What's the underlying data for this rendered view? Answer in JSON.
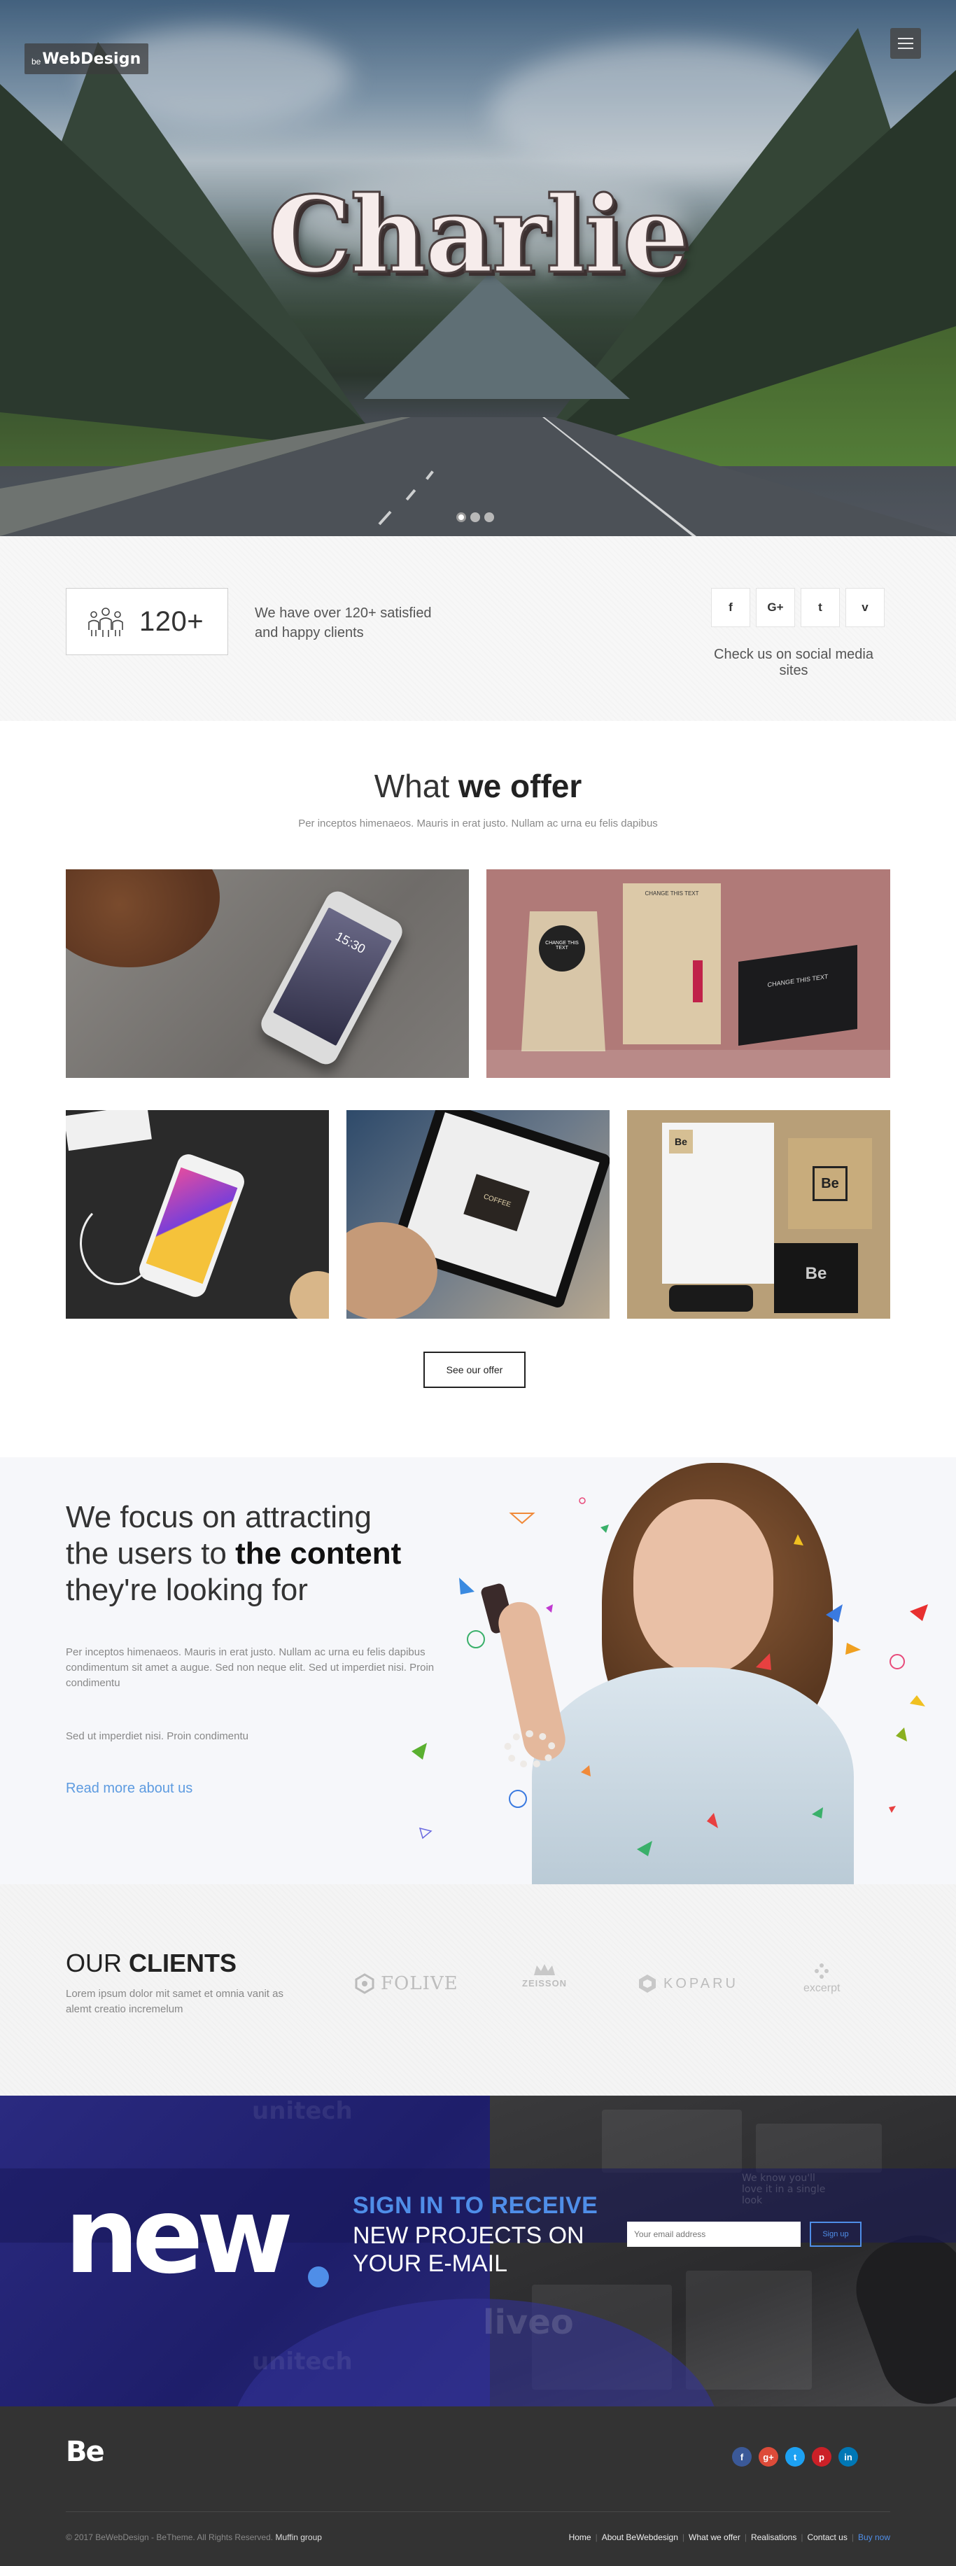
{
  "header": {
    "logo_prefix": "be",
    "logo_name": "WebDesign",
    "menu_icon": "hamburger-icon"
  },
  "hero": {
    "title": "Charlie",
    "slides": 3,
    "active_slide": 1
  },
  "stats": {
    "counter_value": "120+",
    "counter_icon": "people-icon",
    "counter_text": "We have over 120+ satisfied and happy clients",
    "social_caption": "Check us on social media sites",
    "social_buttons": [
      {
        "label": "f",
        "icon": "facebook-icon"
      },
      {
        "label": "G+",
        "icon": "google-plus-icon"
      },
      {
        "label": "t",
        "icon": "twitter-icon"
      },
      {
        "label": "v",
        "icon": "vimeo-icon"
      }
    ]
  },
  "offer": {
    "title_light": "What ",
    "title_bold": "we offer",
    "subtitle": "Per inceptos himenaeos. Mauris in erat justo. Nullam ac urna eu felis dapibus",
    "button_label": "See our offer",
    "tile_texts": {
      "phone_time": "15:30",
      "bag_label": "CHANGE THIS TEXT",
      "box_label": "CHANGE THIS TEXT",
      "badge_label": "Be",
      "tablet_label": "COFFEE"
    }
  },
  "focus": {
    "title_line1": "We focus on attracting",
    "title_line2_light": "the users to ",
    "title_line2_bold": "the content",
    "title_line3": "they're looking for",
    "paragraph1": "Per inceptos himenaeos. Mauris in erat justo. Nullam ac urna eu felis dapibus condimentum sit amet a augue. Sed non neque elit. Sed ut imperdiet nisi. Proin condimentu",
    "paragraph2": "Sed ut imperdiet nisi. Proin condimentu",
    "link": "Read more about us"
  },
  "clients": {
    "title_light": "OUR ",
    "title_bold": "CLIENTS",
    "subtitle": "Lorem ipsum dolor mit samet et omnia vanit as alemt creatio incremelum",
    "logos": [
      "FOLIVE",
      "ZEISSON",
      "KOPARU",
      "excerpt"
    ]
  },
  "newsletter": {
    "big_word": "new",
    "headline_accent": "SIGN IN TO RECEIVE",
    "headline_rest": "NEW PROJECTS ON YOUR E-MAIL",
    "email_placeholder": "Your email address",
    "button_label": "Sign up",
    "bg_words": [
      "unitech",
      "liveo",
      "unitech",
      "We know you'll love it in a single look"
    ]
  },
  "footer": {
    "logo": "Be",
    "copyright": "© 2017 BeWebDesign - BeTheme. All Rights Reserved.",
    "copyright_link": "Muffin group",
    "nav": [
      "Home",
      "About BeWebdesign",
      "What we offer",
      "Realisations",
      "Contact us",
      "Buy now"
    ],
    "socials": [
      {
        "icon": "facebook-icon",
        "label": "f",
        "color": "#3b5998"
      },
      {
        "icon": "google-plus-icon",
        "label": "g+",
        "color": "#dd4b39"
      },
      {
        "icon": "twitter-icon",
        "label": "t",
        "color": "#1da1f2"
      },
      {
        "icon": "pinterest-icon",
        "label": "p",
        "color": "#cb2027"
      },
      {
        "icon": "linkedin-icon",
        "label": "in",
        "color": "#0077b5"
      }
    ]
  },
  "colors": {
    "accent": "#4f8ee8",
    "footer_bg": "#333333",
    "newsletter_blue": "#1e1e6a"
  }
}
